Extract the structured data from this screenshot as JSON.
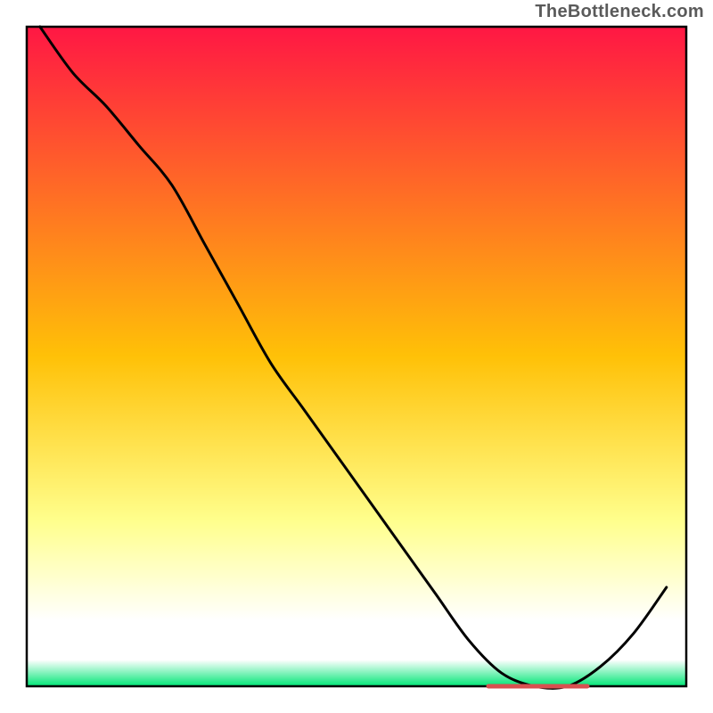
{
  "watermark": "TheBottleneck.com",
  "colors": {
    "top": "#ff1744",
    "mid": "#ffc107",
    "lower": "#ffff8d",
    "bottom_white": "#ffffff",
    "green": "#00e676",
    "curve": "#000000",
    "marker": "#d85050",
    "border": "#000000"
  },
  "chart_data": {
    "type": "line",
    "title": "",
    "xlabel": "",
    "ylabel": "",
    "xlim": [
      0,
      100
    ],
    "ylim": [
      0,
      100
    ],
    "x": [
      2,
      7,
      12,
      17,
      22,
      27,
      32,
      37,
      42,
      47,
      52,
      57,
      62,
      67,
      72,
      77,
      82,
      87,
      92,
      97
    ],
    "values": [
      100,
      93,
      88,
      82,
      76,
      67,
      58,
      49,
      42,
      35,
      28,
      21,
      14,
      7,
      2,
      0,
      0,
      3,
      8,
      15
    ],
    "marker_x_range": [
      70,
      85
    ],
    "marker_y": 0
  }
}
